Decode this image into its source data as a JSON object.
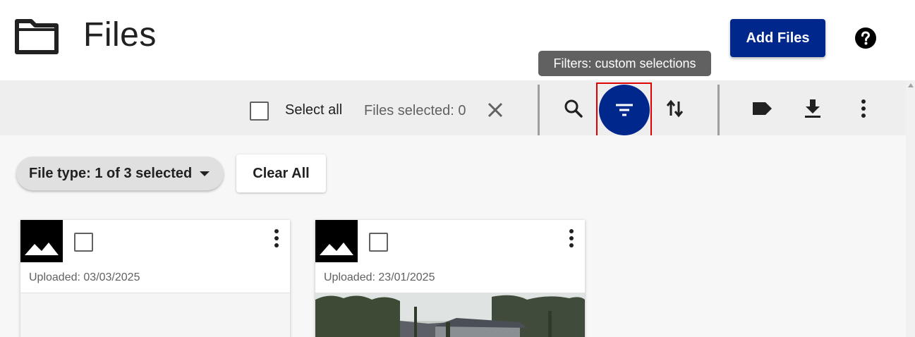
{
  "header": {
    "title": "Files",
    "add_files_label": "Add Files",
    "folder_icon": "folder-icon",
    "help_icon": "help-icon"
  },
  "tooltip": {
    "text": "Filters: custom selections"
  },
  "toolbar": {
    "select_all_label": "Select all",
    "files_selected": "Files selected: 0",
    "icons": [
      "search-icon",
      "filter-icon",
      "sort-icon",
      "tag-icon",
      "download-icon",
      "more-vert-icon"
    ]
  },
  "filters": {
    "file_type_chip": "File type: 1 of 3 selected",
    "clear_all_label": "Clear All"
  },
  "files": [
    {
      "uploaded": "Uploaded: 03/03/2025",
      "thumb_icon": "image-icon"
    },
    {
      "uploaded": "Uploaded: 23/01/2025",
      "thumb_icon": "image-icon"
    }
  ],
  "colors": {
    "primary": "#00288c",
    "highlight": "#e00000",
    "tooltip_bg": "#616161",
    "toolbar_bg": "#eeeeee"
  }
}
